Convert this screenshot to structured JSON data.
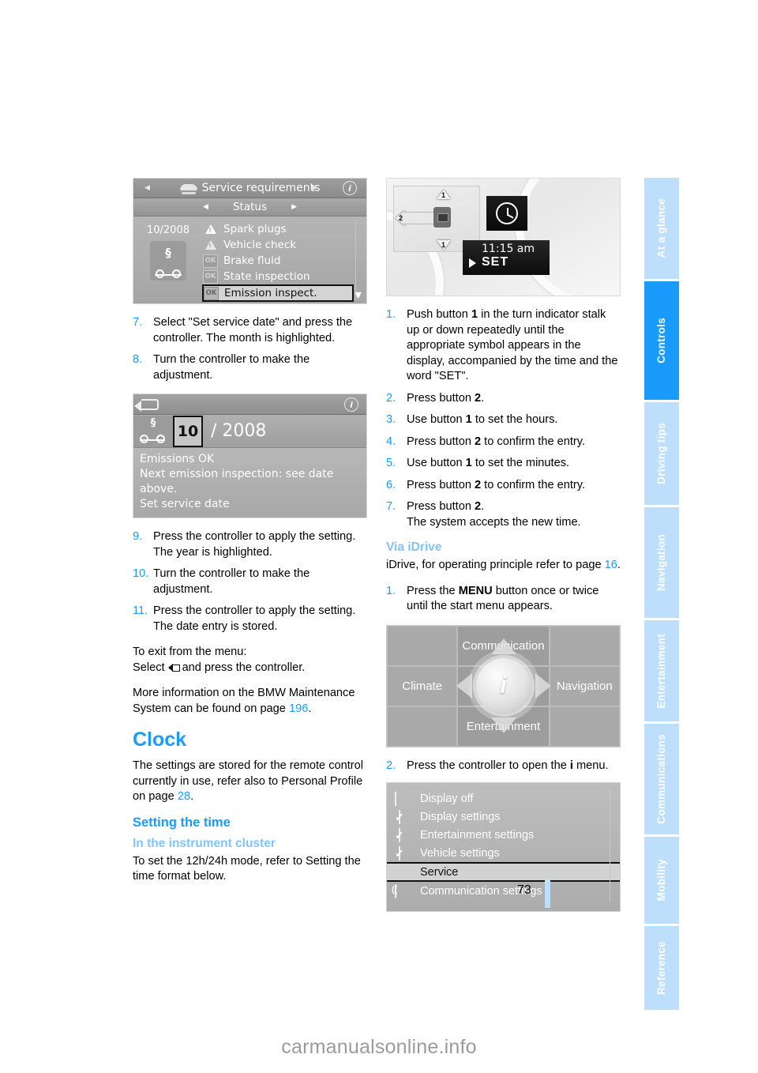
{
  "page": {
    "number": "73",
    "watermark": "carmanualsonline.info"
  },
  "sidebar": {
    "tabs": [
      {
        "label": "At a glance",
        "active": false
      },
      {
        "label": "Controls",
        "active": true
      },
      {
        "label": "Driving tips",
        "active": false
      },
      {
        "label": "Navigation",
        "active": false
      },
      {
        "label": "Entertainment",
        "active": false
      },
      {
        "label": "Communications",
        "active": false
      },
      {
        "label": "Mobility",
        "active": false
      },
      {
        "label": "Reference",
        "active": false
      }
    ],
    "accent_active": "#1a9bfc",
    "accent_inactive": "#bedffc"
  },
  "figures": {
    "service_requirements": {
      "header_title": "Service requirements",
      "subheader_title": "Status",
      "date": "10/2008",
      "items": [
        {
          "badge": "!",
          "badge_type": "warning-triangle",
          "label": "Spark plugs"
        },
        {
          "badge": "!",
          "badge_type": "warning-triangle-light",
          "label": "Vehicle check"
        },
        {
          "badge": "OK",
          "badge_type": "ok",
          "label": "Brake fluid"
        },
        {
          "badge": "OK",
          "badge_type": "ok",
          "label": "State inspection"
        },
        {
          "badge": "OK",
          "badge_type": "ok",
          "label": "Emission inspect.",
          "selected": true
        }
      ]
    },
    "instrument_cluster": {
      "stalk_label_1": "1",
      "stalk_label_2": "2",
      "stalk_label_1b": "1",
      "time": "11:15 am",
      "set_word": "SET"
    },
    "date_setting": {
      "month": "10",
      "year": "/ 2008",
      "lines": [
        "Emissions OK",
        "Next emission inspection: see date",
        "above.",
        "Set service date"
      ]
    },
    "idrive_start_menu": {
      "top": "Communication",
      "left": "Climate",
      "right": "Navigation",
      "bottom": "Entertainment",
      "center_icon": "i"
    },
    "i_menu": {
      "items": [
        {
          "label": "Display off",
          "icon": "empty-box-icon",
          "selected": false
        },
        {
          "label": "Display settings",
          "icon": "check-box-icon",
          "selected": false
        },
        {
          "label": "Entertainment settings",
          "icon": "check-entertainment-icon",
          "selected": false
        },
        {
          "label": "Vehicle settings",
          "icon": "check-vehicle-icon",
          "selected": false
        },
        {
          "label": "Service",
          "icon": "car-icon",
          "selected": true
        },
        {
          "label": "Communication settings",
          "icon": "antenna-icon",
          "selected": false
        }
      ]
    }
  },
  "left_column": {
    "steps_a": [
      {
        "num": "7.",
        "text": "Select \"Set service date\" and press the controller. The month is highlighted."
      },
      {
        "num": "8.",
        "text": "Turn the controller to make the adjustment."
      }
    ],
    "steps_b": [
      {
        "num": "9.",
        "text": "Press the controller to apply the setting. The year is highlighted."
      },
      {
        "num": "10.",
        "text": "Turn the controller to make the adjustment."
      },
      {
        "num": "11.",
        "text": "Press the controller to apply the setting. The date entry is stored."
      }
    ],
    "exit_line1": "To exit from the menu:",
    "exit_line2_pre": "Select",
    "exit_line2_post": "and press the controller.",
    "more_info_pre": "More information on the BMW Maintenance System can be found on page",
    "more_info_page": "196",
    "more_info_post": ".",
    "clock_heading": "Clock",
    "clock_body_pre": "The settings are stored for the remote control currently in use, refer also to Personal Profile on page",
    "clock_body_page": "28",
    "clock_body_post": ".",
    "setting_time_heading": "Setting the time",
    "instrument_cluster_heading": "In the instrument cluster",
    "instrument_cluster_body": "To set the 12h/24h mode, refer to Setting the time format below."
  },
  "right_column": {
    "steps": [
      {
        "num": "1.",
        "parts": [
          {
            "t": "Push button "
          },
          {
            "t": "1",
            "b": true
          },
          {
            "t": " in the turn indicator stalk up or down repeatedly until the appropriate symbol appears in the display, accompanied by the time and the word \"SET\"."
          }
        ]
      },
      {
        "num": "2.",
        "parts": [
          {
            "t": "Press button "
          },
          {
            "t": "2",
            "b": true
          },
          {
            "t": "."
          }
        ]
      },
      {
        "num": "3.",
        "parts": [
          {
            "t": "Use button "
          },
          {
            "t": "1",
            "b": true
          },
          {
            "t": " to set the hours."
          }
        ]
      },
      {
        "num": "4.",
        "parts": [
          {
            "t": "Press button "
          },
          {
            "t": "2",
            "b": true
          },
          {
            "t": " to confirm the entry."
          }
        ]
      },
      {
        "num": "5.",
        "parts": [
          {
            "t": "Use button "
          },
          {
            "t": "1",
            "b": true
          },
          {
            "t": " to set the minutes."
          }
        ]
      },
      {
        "num": "6.",
        "parts": [
          {
            "t": "Press button "
          },
          {
            "t": "2",
            "b": true
          },
          {
            "t": " to confirm the entry."
          }
        ]
      },
      {
        "num": "7.",
        "parts": [
          {
            "t": "Press button "
          },
          {
            "t": "2",
            "b": true
          },
          {
            "t": ".\nThe system accepts the new time."
          }
        ]
      }
    ],
    "via_idrive_heading": "Via iDrive",
    "via_idrive_body_pre": "iDrive, for operating principle refer to page",
    "via_idrive_body_page": "16",
    "via_idrive_body_post": ".",
    "idrive_step1_num": "1.",
    "idrive_step1_pre": "Press the ",
    "idrive_step1_menu": "MENU",
    "idrive_step1_post": " button once or twice until the start menu appears.",
    "idrive_step2_num": "2.",
    "idrive_step2_pre": "Press the controller to open the ",
    "idrive_step2_i": "i",
    "idrive_step2_post": " menu."
  }
}
